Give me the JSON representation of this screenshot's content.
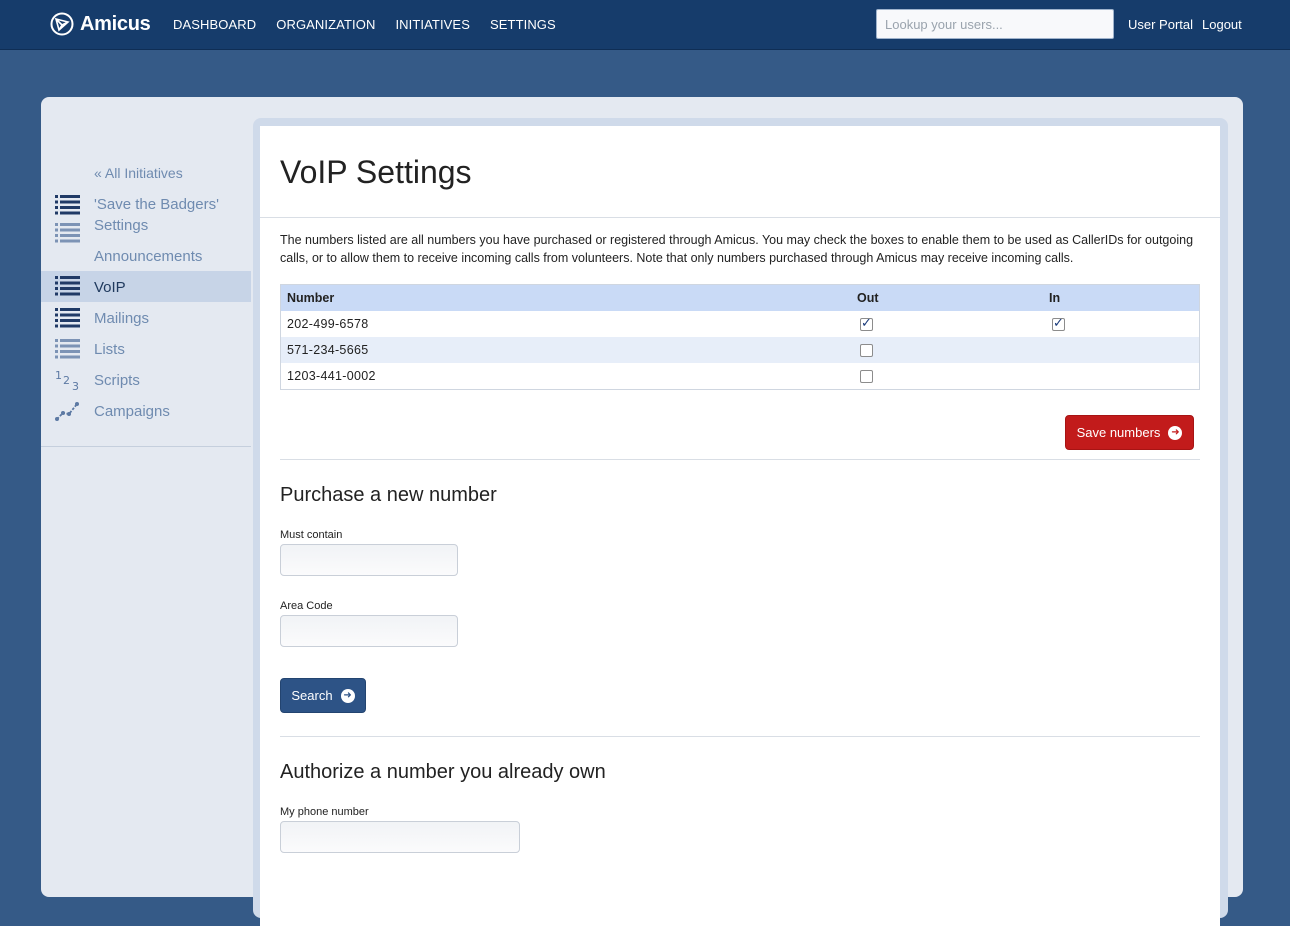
{
  "app": {
    "name": "Amicus",
    "nav": [
      "DASHBOARD",
      "ORGANIZATION",
      "INITIATIVES",
      "SETTINGS"
    ],
    "search_placeholder": "Lookup your users...",
    "user_portal": "User Portal",
    "logout": "Logout"
  },
  "sidebar": {
    "back_label": "« All Initiatives",
    "items": [
      {
        "label": "'Save the Badgers' Settings",
        "icon": "list-icon",
        "active": false
      },
      {
        "label": "Announcements",
        "icon": "list-icon",
        "active": false
      },
      {
        "label": "VoIP",
        "icon": "list-icon",
        "active": true
      },
      {
        "label": "Mailings",
        "icon": "list-icon",
        "active": false
      },
      {
        "label": "Lists",
        "icon": "list-icon",
        "active": false
      },
      {
        "label": "Scripts",
        "icon": "numbers-icon",
        "active": false
      },
      {
        "label": "Campaigns",
        "icon": "line-chart-icon",
        "active": false
      }
    ]
  },
  "page": {
    "title": "VoIP Settings",
    "description": "The numbers listed are all numbers you have purchased or registered through Amicus. You may check the boxes to enable them to be used as CallerIDs for outgoing calls, or to allow them to receive incoming calls from volunteers. Note that only numbers purchased through Amicus may receive incoming calls.",
    "table": {
      "headers": [
        "Number",
        "Out",
        "In"
      ],
      "rows": [
        {
          "number": "202-499-6578",
          "out": true,
          "in": true
        },
        {
          "number": "571-234-5665",
          "out": false,
          "in": null
        },
        {
          "number": "1203-441-0002",
          "out": false,
          "in": null
        }
      ]
    },
    "save_button": "Save numbers",
    "purchase": {
      "title": "Purchase a new number",
      "must_contain_label": "Must contain",
      "area_code_label": "Area Code",
      "search_button": "Search"
    },
    "authorize": {
      "title": "Authorize a number you already own",
      "phone_label": "My phone number"
    }
  },
  "colors": {
    "background": "#355a87",
    "topbar": "#163c6b",
    "save_button": "#c21b1b",
    "search_button": "#2d5386",
    "table_header": "#c9daf6"
  }
}
